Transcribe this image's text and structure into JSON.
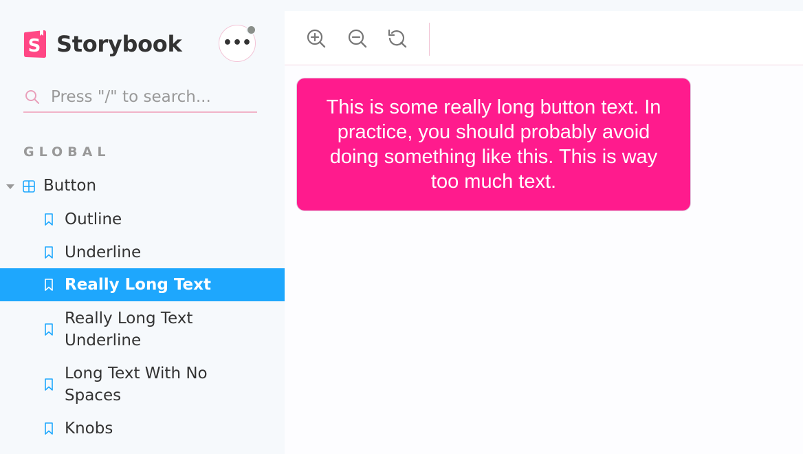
{
  "brand": {
    "name": "Storybook",
    "accent": "#ff4785"
  },
  "menu": {
    "label": "•••"
  },
  "search": {
    "placeholder": "Press \"/\" to search..."
  },
  "sidebar": {
    "section_title": "GLOBAL",
    "root": {
      "label": "Button",
      "icon": "component-icon"
    },
    "items": [
      {
        "label": "Outline",
        "icon": "bookmark-icon",
        "selected": false
      },
      {
        "label": "Underline",
        "icon": "bookmark-icon",
        "selected": false
      },
      {
        "label": "Really Long Text",
        "icon": "bookmark-icon",
        "selected": true
      },
      {
        "label": "Really Long Text Underline",
        "icon": "bookmark-icon",
        "selected": false
      },
      {
        "label": "Long Text With No Spaces",
        "icon": "bookmark-icon",
        "selected": false
      },
      {
        "label": "Knobs",
        "icon": "bookmark-icon",
        "selected": false
      }
    ]
  },
  "toolbar": {
    "zoom_in": "zoom-in-icon",
    "zoom_out": "zoom-out-icon",
    "reset": "zoom-reset-icon"
  },
  "preview": {
    "button_text": "This is some really long button text. In practice, you should probably avoid doing something like this. This is way too much text.",
    "button_color": "#ff1b8d"
  },
  "colors": {
    "selected": "#1ea7fd",
    "text": "#333333",
    "muted": "#999999"
  }
}
